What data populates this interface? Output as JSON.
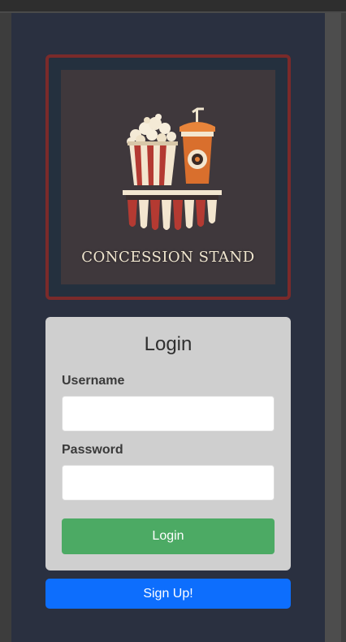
{
  "logo": {
    "text": "CONCESSION STAND"
  },
  "login": {
    "title": "Login",
    "username_label": "Username",
    "username_value": "",
    "password_label": "Password",
    "password_value": "",
    "submit_label": "Login"
  },
  "signup": {
    "label": "Sign Up!"
  },
  "colors": {
    "page_background": "#2a3040",
    "logo_border": "#7a2a2a",
    "card_background": "#cfcfcf",
    "login_button": "#4caa64",
    "signup_button": "#0d6efd"
  }
}
